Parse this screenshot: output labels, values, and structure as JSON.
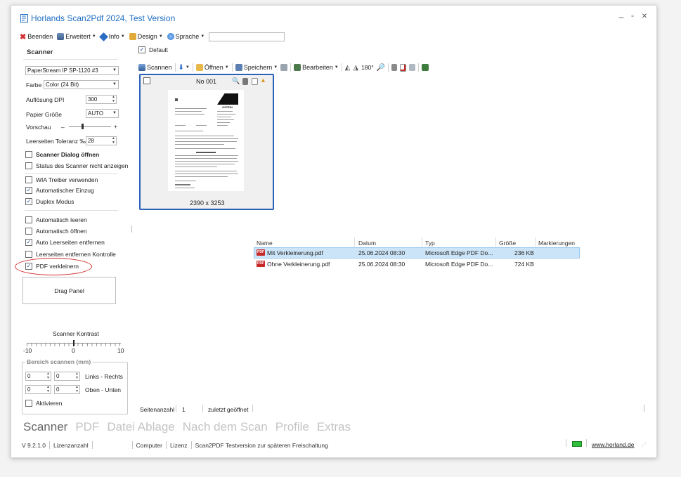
{
  "window": {
    "title": "Horlands Scan2Pdf 2024, Test Version",
    "min": "–",
    "max": "▫",
    "close": "✕"
  },
  "menu": [
    {
      "label": "Beenden",
      "icon": "close-red-icon",
      "caret": false
    },
    {
      "label": "Erweitert",
      "icon": "scanner-icon",
      "caret": true
    },
    {
      "label": "Info",
      "icon": "info-icon",
      "caret": true
    },
    {
      "label": "Design",
      "icon": "brush-icon",
      "caret": true
    },
    {
      "label": "Sprache",
      "icon": "globe-icon",
      "caret": true
    }
  ],
  "scanner": {
    "heading": "Scanner",
    "device": "PaperStream IP SP-1120 #3",
    "farbe_label": "Farbe",
    "farbe_value": "Color (24 Bit)",
    "dpi_label": "Auflösung DPI",
    "dpi_value": "300",
    "papier_label": "Papier Größe",
    "papier_value": "AUTO",
    "vorschau_label": "Vorschau",
    "vorschau_minus": "–",
    "vorschau_plus": "+",
    "toleranz_label": "Leerseiten Toleranz ‰",
    "toleranz_value": "28"
  },
  "checks": [
    {
      "label": "Scanner Dialog öffnen",
      "checked": false,
      "bold": true
    },
    {
      "label": "Status des Scanner nicht anzeigen",
      "checked": false
    },
    {
      "label": "WIA Treiber verwenden",
      "checked": false
    },
    {
      "label": "Automatischer Einzug",
      "checked": true
    },
    {
      "label": "Duplex Modus",
      "checked": true
    },
    {
      "label": "Automatisch leeren",
      "checked": false
    },
    {
      "label": "Automatisch öffnen",
      "checked": false
    },
    {
      "label": "Auto Leerseiten entfernen",
      "checked": true
    },
    {
      "label": "Leerseiten entfernen Kontrolle",
      "checked": false
    },
    {
      "label": "PDF verkleinern",
      "checked": true
    }
  ],
  "drag_panel": "Drag Panel",
  "kontrast": {
    "label": "Scanner Kontrast",
    "min": "-10",
    "mid": "0",
    "max": "10"
  },
  "bereich": {
    "legend": "Bereich scannen (mm)",
    "row1_a": "0",
    "row1_b": "0",
    "row1_label": "Links - Rechts",
    "row2_a": "0",
    "row2_b": "0",
    "row2_label": "Oben - Unten",
    "aktivieren": "Aktivieren"
  },
  "default_label": "Default",
  "toolbar": {
    "scannen": "Scannen",
    "oeffnen": "Öffnen",
    "speichern": "Speichern",
    "bearbeiten": "Bearbeiten",
    "rotate": "180°"
  },
  "thumb": {
    "title": "No 001",
    "size": "2390 x 3253",
    "logo": "OSTEIN"
  },
  "files": {
    "headers": [
      "Name",
      "Datum",
      "Typ",
      "Größe",
      "Markierungen"
    ],
    "rows": [
      {
        "name": "Mit Verkleinerung.pdf",
        "date": "25.06.2024 08:30",
        "type": "Microsoft Edge PDF Do...",
        "size": "236 KB",
        "selected": true
      },
      {
        "name": "Ohne Verkleinerung.pdf",
        "date": "25.06.2024 08:30",
        "type": "Microsoft Edge PDF Do...",
        "size": "724 KB",
        "selected": false
      }
    ]
  },
  "pagebar": {
    "label": "Seitenanzahl",
    "value": "1",
    "last": "zuletzt geöffnet"
  },
  "tabs": [
    "Scanner",
    "PDF",
    "Datei Ablage",
    "Nach dem Scan",
    "Profile",
    "Extras"
  ],
  "status": {
    "version": "V 9.2.1.0",
    "lizenzanzahl": "Lizenzanzahl",
    "computer": "Computer",
    "lizenz": "Lizenz",
    "message": "Scan2PDF Testversion zur späteren Freischaltung",
    "link": "www.horland.de"
  },
  "colors": {
    "accent": "#2a62b8",
    "title": "#1f6fc4",
    "highlight": "#cce4f7",
    "annotation": "#d32f2f"
  }
}
